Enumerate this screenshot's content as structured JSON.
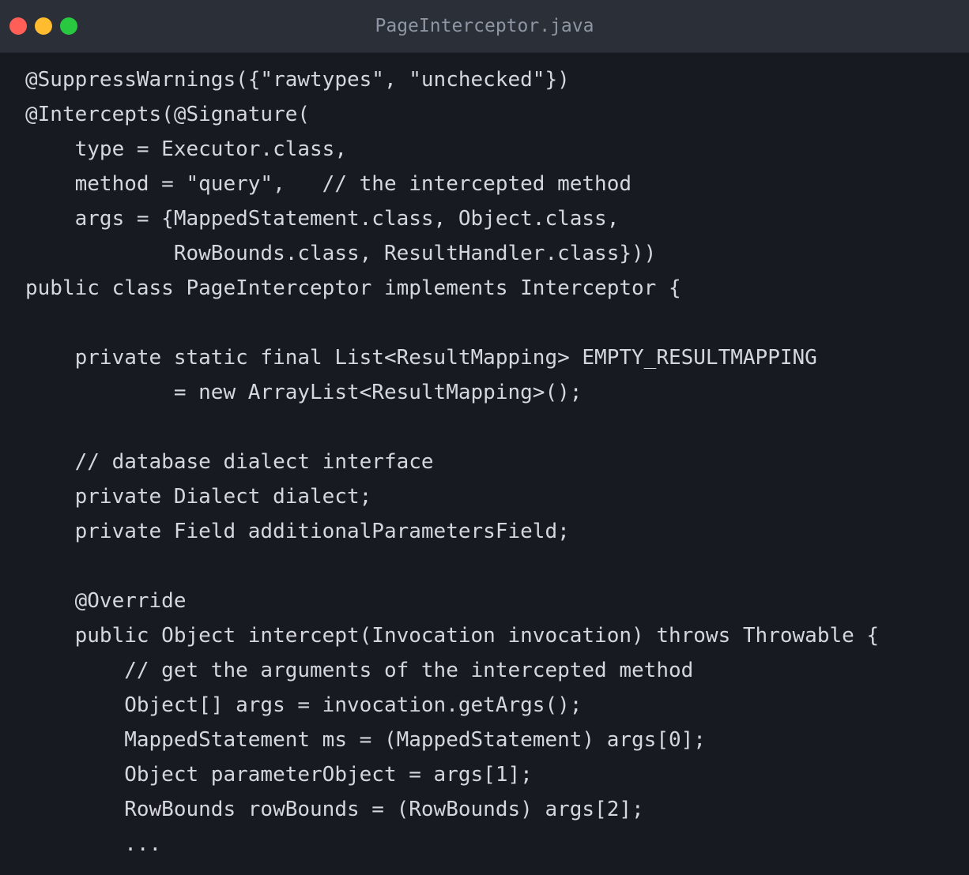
{
  "window": {
    "title": "PageInterceptor.java",
    "buttons": [
      {
        "name": "close",
        "color": "#ff5f57"
      },
      {
        "name": "minimize",
        "color": "#febc2e"
      },
      {
        "name": "zoom",
        "color": "#28c840"
      }
    ]
  },
  "colors": {
    "background": "#181a22",
    "titlebar": "#2b2f38",
    "text": "#d4d7dd",
    "title_text": "#8f96a3"
  },
  "code": {
    "language": "java",
    "lines": [
      "@SuppressWarnings({\"rawtypes\", \"unchecked\"})",
      "@Intercepts(@Signature(",
      "    type = Executor.class,",
      "    method = \"query\",   // the intercepted method",
      "    args = {MappedStatement.class, Object.class,",
      "            RowBounds.class, ResultHandler.class}))",
      "public class PageInterceptor implements Interceptor {",
      "",
      "    private static final List<ResultMapping> EMPTY_RESULTMAPPING",
      "            = new ArrayList<ResultMapping>();",
      "",
      "    // database dialect interface",
      "    private Dialect dialect;",
      "    private Field additionalParametersField;",
      "",
      "    @Override",
      "    public Object intercept(Invocation invocation) throws Throwable {",
      "        // get the arguments of the intercepted method",
      "        Object[] args = invocation.getArgs();",
      "        MappedStatement ms = (MappedStatement) args[0];",
      "        Object parameterObject = args[1];",
      "        RowBounds rowBounds = (RowBounds) args[2];",
      "        ..."
    ]
  }
}
